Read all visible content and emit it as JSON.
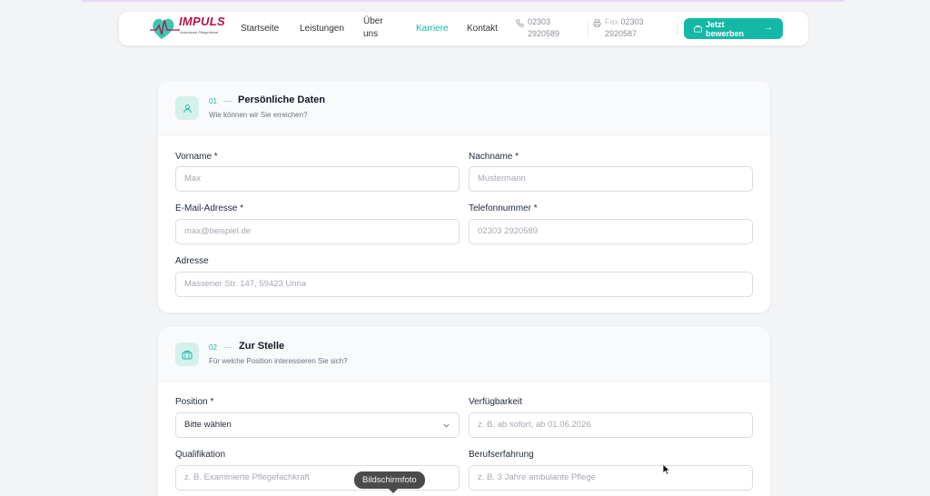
{
  "brand": {
    "name": "IMPULS",
    "tagline": "Ambulante Pflegedienst",
    "colors": {
      "primary": "#14b8a6",
      "logo": "#b3124a"
    }
  },
  "nav": {
    "items": [
      {
        "label": "Startseite"
      },
      {
        "label": "Leistungen"
      },
      {
        "label": "Über uns"
      },
      {
        "label": "Karriere",
        "active": true
      },
      {
        "label": "Kontakt"
      }
    ],
    "phone": "02303 2920589",
    "fax_label": "Fax",
    "fax": "02303 2920587",
    "cta": "Jetzt bewerben"
  },
  "section1": {
    "num": "01",
    "title": "Persönliche Daten",
    "subtitle": "Wie können wir Sie erreichen?",
    "fields": {
      "vorname": {
        "label": "Vorname *",
        "placeholder": "Max"
      },
      "nachname": {
        "label": "Nachname *",
        "placeholder": "Mustermann"
      },
      "email": {
        "label": "E-Mail-Adresse *",
        "placeholder": "max@beispiel.de"
      },
      "telefon": {
        "label": "Telefonnummer *",
        "placeholder": "02303 2920589"
      },
      "adresse": {
        "label": "Adresse",
        "placeholder": "Massener Str. 147, 59423 Unna"
      }
    }
  },
  "section2": {
    "num": "02",
    "title": "Zur Stelle",
    "subtitle": "Für welche Position interessieren Sie sich?",
    "fields": {
      "position": {
        "label": "Position *",
        "value": "Bitte wählen"
      },
      "verfuegbarkeit": {
        "label": "Verfügbarkeit",
        "placeholder": "z. B. ab sofort, ab 01.06.2026"
      },
      "qualifikation": {
        "label": "Qualifikation",
        "placeholder": "z. B. Examinierte Pflegefachkraft"
      },
      "berufserfahrung": {
        "label": "Berufserfahrung",
        "placeholder": "z. B. 3 Jahre ambulante Pflege"
      }
    }
  },
  "tooltip": "Bildschirmfoto"
}
